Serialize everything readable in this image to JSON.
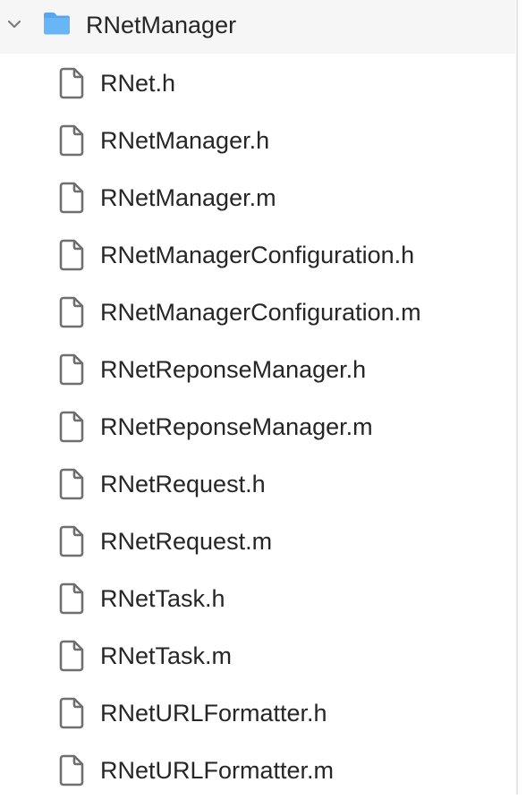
{
  "tree": {
    "folder": {
      "name": "RNetManager",
      "expanded": true,
      "icon": "folder-icon",
      "color": "#5aa6ee"
    },
    "files": [
      {
        "name": "RNet.h",
        "icon": "file-icon"
      },
      {
        "name": "RNetManager.h",
        "icon": "file-icon"
      },
      {
        "name": "RNetManager.m",
        "icon": "file-icon"
      },
      {
        "name": "RNetManagerConfiguration.h",
        "icon": "file-icon"
      },
      {
        "name": "RNetManagerConfiguration.m",
        "icon": "file-icon"
      },
      {
        "name": "RNetReponseManager.h",
        "icon": "file-icon"
      },
      {
        "name": "RNetReponseManager.m",
        "icon": "file-icon"
      },
      {
        "name": "RNetRequest.h",
        "icon": "file-icon"
      },
      {
        "name": "RNetRequest.m",
        "icon": "file-icon"
      },
      {
        "name": "RNetTask.h",
        "icon": "file-icon"
      },
      {
        "name": "RNetTask.m",
        "icon": "file-icon"
      },
      {
        "name": "RNetURLFormatter.h",
        "icon": "file-icon"
      },
      {
        "name": "RNetURLFormatter.m",
        "icon": "file-icon"
      }
    ]
  }
}
